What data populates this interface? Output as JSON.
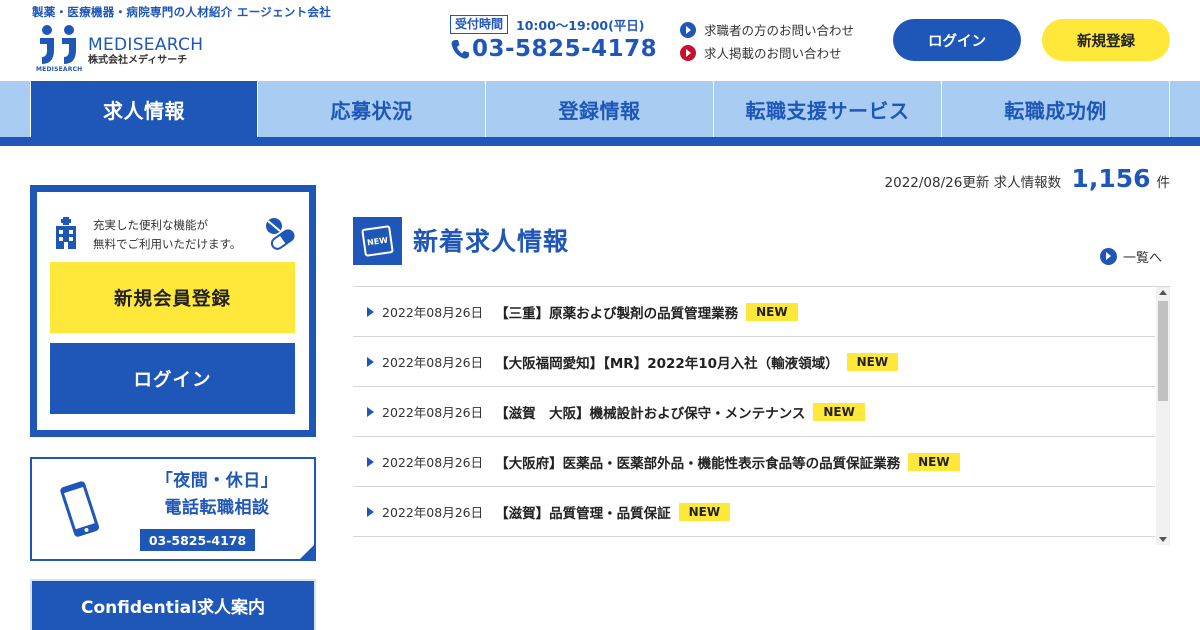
{
  "header": {
    "tagline": "製薬・医療機器・病院専門の人材紹介 エージェント会社",
    "logo_name": "MEDISEARCH",
    "logo_sub": "株式会社メディサーチ",
    "logo_mini": "MEDISEARCH",
    "hours_label": "受付時間",
    "hours_value": "10:00〜19:00(平日)",
    "phone": "03-5825-4178",
    "contact_seeker": "求職者の方のお問い合わせ",
    "contact_employer": "求人掲載のお問い合わせ",
    "login_label": "ログイン",
    "register_label": "新規登録"
  },
  "nav": {
    "items": [
      {
        "label": "求人情報"
      },
      {
        "label": "応募状況"
      },
      {
        "label": "登録情報"
      },
      {
        "label": "転職支援サービス"
      },
      {
        "label": "転職成功例"
      }
    ]
  },
  "sidebar": {
    "message_line1": "充実した便利な機能が",
    "message_line2": "無料でご利用いただけます。",
    "register_label": "新規会員登録",
    "login_label": "ログイン",
    "consult_line1": "「夜間・休日」",
    "consult_line2": "電話転職相談",
    "consult_phone": "03-5825-4178",
    "confidential_label": "Confidential求人案内"
  },
  "main": {
    "update_date": "2022/08/26更新",
    "count_label": "求人情報数",
    "count_value": "1,156",
    "count_unit": "件",
    "new_icon_text": "NEW",
    "section_title": "新着求人情報",
    "view_all": "一覧へ",
    "jobs": [
      {
        "date": "2022年08月26日",
        "title": "【三重】原薬および製剤の品質管理業務",
        "badge": "NEW"
      },
      {
        "date": "2022年08月26日",
        "title": "【大阪福岡愛知】【MR】2022年10月入社（輸液領域）",
        "badge": "NEW"
      },
      {
        "date": "2022年08月26日",
        "title": "【滋賀　大阪】機械設計および保守・メンテナンス",
        "badge": "NEW"
      },
      {
        "date": "2022年08月26日",
        "title": "【大阪府】医薬品・医薬部外品・機能性表示食品等の品質保証業務",
        "badge": "NEW"
      },
      {
        "date": "2022年08月26日",
        "title": "【滋賀】品質管理・品質保証",
        "badge": "NEW"
      }
    ]
  },
  "colors": {
    "primary": "#1f57b8",
    "nav_bg": "#a8ccf2",
    "accent_yellow": "#ffe83a",
    "red": "#c8102e"
  }
}
